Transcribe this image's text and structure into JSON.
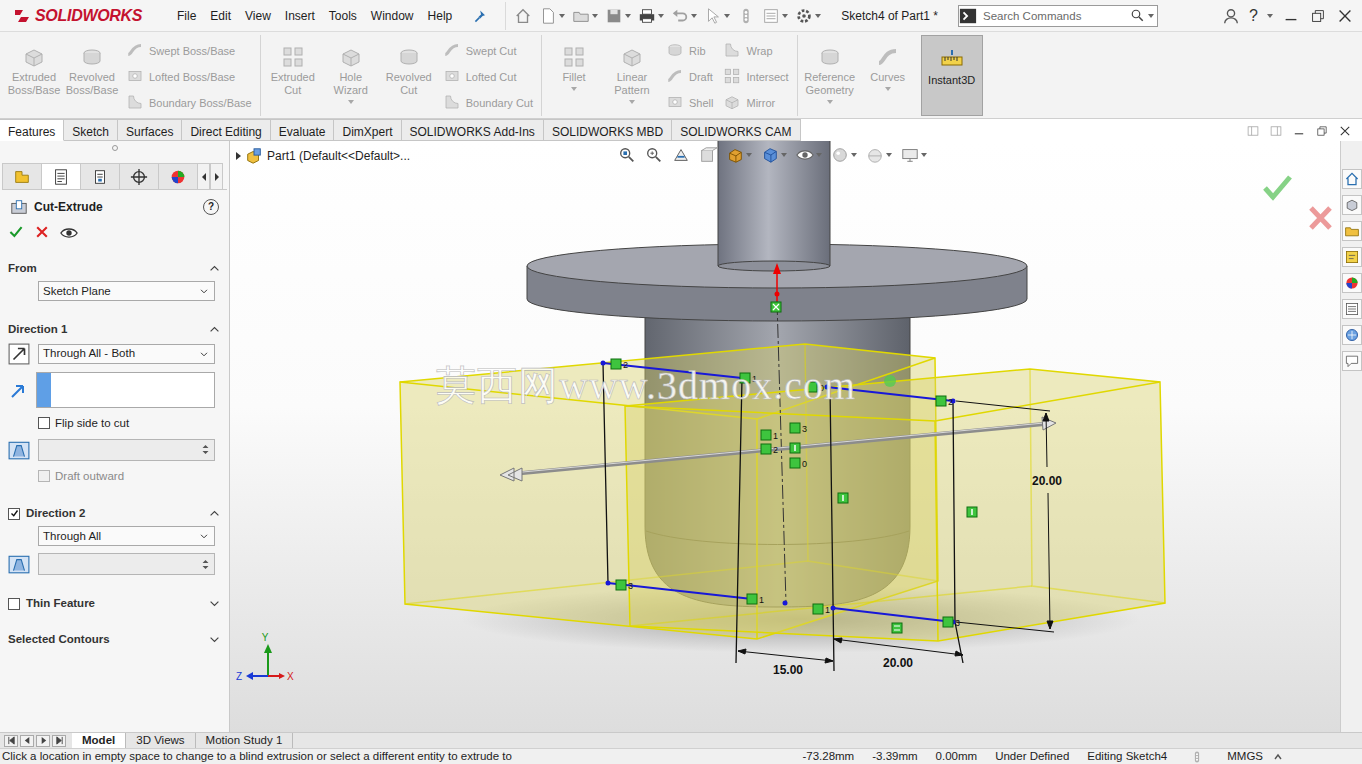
{
  "titlebar": {
    "logo": "SOLIDWORKS",
    "menu": [
      "File",
      "Edit",
      "View",
      "Insert",
      "Tools",
      "Window",
      "Help"
    ],
    "title": "Sketch4 of Part1 *",
    "search": {
      "placeholder": "Search Commands"
    },
    "help": "?"
  },
  "ribbon": {
    "groups": [
      {
        "columns": [
          {
            "kind": "large",
            "buttons": [
              {
                "label": "Extruded Boss/Base",
                "disabled": true,
                "active": false,
                "dropdown": false
              }
            ]
          },
          {
            "kind": "large",
            "buttons": [
              {
                "label": "Revolved Boss/Base",
                "disabled": true,
                "active": false,
                "dropdown": false
              }
            ]
          },
          {
            "kind": "stack",
            "buttons": [
              {
                "label": "Swept Boss/Base",
                "disabled": true,
                "active": false,
                "dropdown": false
              },
              {
                "label": "Lofted Boss/Base",
                "disabled": true,
                "active": false,
                "dropdown": false
              },
              {
                "label": "Boundary Boss/Base",
                "disabled": true,
                "active": false,
                "dropdown": false
              }
            ]
          }
        ]
      },
      {
        "columns": [
          {
            "kind": "large",
            "buttons": [
              {
                "label": "Extruded Cut",
                "disabled": true,
                "active": false,
                "dropdown": false
              }
            ]
          },
          {
            "kind": "large",
            "buttons": [
              {
                "label": "Hole Wizard",
                "disabled": true,
                "active": false,
                "dropdown": true
              }
            ]
          },
          {
            "kind": "large",
            "buttons": [
              {
                "label": "Revolved Cut",
                "disabled": true,
                "active": false,
                "dropdown": false
              }
            ]
          },
          {
            "kind": "stack",
            "buttons": [
              {
                "label": "Swept Cut",
                "disabled": true,
                "active": false,
                "dropdown": false
              },
              {
                "label": "Lofted Cut",
                "disabled": true,
                "active": false,
                "dropdown": false
              },
              {
                "label": "Boundary Cut",
                "disabled": true,
                "active": false,
                "dropdown": false
              }
            ]
          }
        ]
      },
      {
        "columns": [
          {
            "kind": "large",
            "buttons": [
              {
                "label": "Fillet",
                "disabled": true,
                "active": false,
                "dropdown": true
              }
            ]
          },
          {
            "kind": "large",
            "buttons": [
              {
                "label": "Linear Pattern",
                "disabled": true,
                "active": false,
                "dropdown": true
              }
            ]
          },
          {
            "kind": "stack",
            "buttons": [
              {
                "label": "Rib",
                "disabled": true,
                "active": false,
                "dropdown": false
              },
              {
                "label": "Draft",
                "disabled": true,
                "active": false,
                "dropdown": false
              },
              {
                "label": "Shell",
                "disabled": true,
                "active": false,
                "dropdown": false
              }
            ]
          },
          {
            "kind": "stack",
            "buttons": [
              {
                "label": "Wrap",
                "disabled": true,
                "active": false,
                "dropdown": false
              },
              {
                "label": "Intersect",
                "disabled": true,
                "active": false,
                "dropdown": false
              },
              {
                "label": "Mirror",
                "disabled": true,
                "active": false,
                "dropdown": false
              }
            ]
          }
        ]
      },
      {
        "columns": [
          {
            "kind": "large",
            "buttons": [
              {
                "label": "Reference Geometry",
                "disabled": true,
                "active": false,
                "dropdown": true
              }
            ]
          },
          {
            "kind": "large",
            "buttons": [
              {
                "label": "Curves",
                "disabled": true,
                "active": false,
                "dropdown": true
              }
            ]
          },
          {
            "kind": "large",
            "buttons": [
              {
                "label": "Instant3D",
                "disabled": false,
                "active": true,
                "dropdown": false
              }
            ]
          }
        ]
      }
    ]
  },
  "tabs": [
    {
      "label": "Features",
      "selected": true
    },
    {
      "label": "Sketch",
      "selected": false
    },
    {
      "label": "Surfaces",
      "selected": false
    },
    {
      "label": "Direct Editing",
      "selected": false
    },
    {
      "label": "Evaluate",
      "selected": false
    },
    {
      "label": "DimXpert",
      "selected": false
    },
    {
      "label": "SOLIDWORKS Add-Ins",
      "selected": false
    },
    {
      "label": "SOLIDWORKS MBD",
      "selected": false
    },
    {
      "label": "SOLIDWORKS CAM",
      "selected": false
    }
  ],
  "property_manager": {
    "tabs": [
      {
        "selected": false
      },
      {
        "selected": true
      },
      {
        "selected": false
      },
      {
        "selected": false
      },
      {
        "selected": false
      }
    ],
    "title": "Cut-Extrude",
    "help": "?",
    "sections": [
      {
        "kind": "from",
        "title": "From",
        "expanded": true,
        "value": "Sketch Plane"
      },
      {
        "kind": "direction",
        "title": "Direction 1",
        "expanded": true,
        "end_condition": "Through All - Both",
        "selection": "",
        "flip": {
          "label": "Flip side to cut",
          "checked": false,
          "disabled": false
        },
        "draft_angle": {
          "value": "",
          "disabled": true
        },
        "draft": {
          "label": "Draft outward",
          "checked": false,
          "disabled": true
        }
      },
      {
        "kind": "direction2",
        "title": "Direction 2",
        "checked": true,
        "expanded": true,
        "end_condition": "Through All",
        "draft_angle": {
          "value": "",
          "disabled": true
        }
      },
      {
        "kind": "option",
        "title": "Thin Feature",
        "checked": false,
        "expanded": false
      },
      {
        "kind": "option",
        "title": "Selected Contours",
        "expanded": false
      }
    ]
  },
  "graphics": {
    "tree": "Part1 (Default<<Default>...",
    "watermark": "莫西网www.3dmox.com",
    "dimensions": [
      "20.00",
      "15.00",
      "20.00"
    ],
    "markers": [
      "2",
      "1",
      "0",
      "2",
      "1",
      "3",
      "2",
      "0",
      "3",
      "1",
      "1",
      "3"
    ],
    "triad": {
      "x": "X",
      "y": "Y",
      "z": "Z"
    }
  },
  "bottom_tabs": [
    {
      "label": "Model",
      "selected": true
    },
    {
      "label": "3D Views",
      "selected": false
    },
    {
      "label": "Motion Study 1",
      "selected": false
    }
  ],
  "status_bar": {
    "message": "Click a location in empty space to change to a blind extrusion or select a different entity to extrude to",
    "x": "-73.28mm",
    "y": "-3.39mm",
    "z": "0.00mm",
    "state": "Under Defined",
    "mode": "Editing Sketch4",
    "units": "MMGS"
  }
}
